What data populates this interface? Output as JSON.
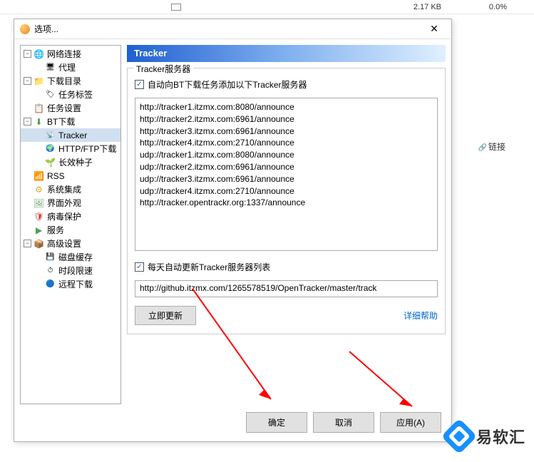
{
  "bg": {
    "size": "2.17 KB",
    "pct": "0.0%",
    "link": "链接"
  },
  "dialog": {
    "title": "选项..."
  },
  "tree": [
    {
      "label": "网络连接",
      "icon": "ic-globe",
      "indent": 0,
      "toggle": "−"
    },
    {
      "label": "代理",
      "icon": "ic-server",
      "indent": 1,
      "toggle": ""
    },
    {
      "label": "下载目录",
      "icon": "ic-folder",
      "indent": 0,
      "toggle": "−"
    },
    {
      "label": "任务标签",
      "icon": "ic-tag",
      "indent": 1,
      "toggle": ""
    },
    {
      "label": "任务设置",
      "icon": "ic-task",
      "indent": 0,
      "toggle": ""
    },
    {
      "label": "BT下载",
      "icon": "ic-bt",
      "indent": 0,
      "toggle": "−"
    },
    {
      "label": "Tracker",
      "icon": "ic-tracker",
      "indent": 1,
      "toggle": "",
      "selected": true
    },
    {
      "label": "HTTP/FTP下载",
      "icon": "ic-http",
      "indent": 1,
      "toggle": ""
    },
    {
      "label": "长效种子",
      "icon": "ic-seed",
      "indent": 1,
      "toggle": ""
    },
    {
      "label": "RSS",
      "icon": "ic-rss",
      "indent": 0,
      "toggle": ""
    },
    {
      "label": "系统集成",
      "icon": "ic-sys",
      "indent": 0,
      "toggle": ""
    },
    {
      "label": "界面外观",
      "icon": "ic-ui",
      "indent": 0,
      "toggle": ""
    },
    {
      "label": "病毒保护",
      "icon": "ic-virus",
      "indent": 0,
      "toggle": ""
    },
    {
      "label": "服务",
      "icon": "ic-service",
      "indent": 0,
      "toggle": ""
    },
    {
      "label": "高级设置",
      "icon": "ic-adv",
      "indent": 0,
      "toggle": "−"
    },
    {
      "label": "磁盘缓存",
      "icon": "ic-disk",
      "indent": 1,
      "toggle": ""
    },
    {
      "label": "时段限速",
      "icon": "ic-time",
      "indent": 1,
      "toggle": ""
    },
    {
      "label": "远程下载",
      "icon": "ic-remote",
      "indent": 1,
      "toggle": ""
    }
  ],
  "panel": {
    "header": "Tracker",
    "fieldset_legend": "Tracker服务器",
    "chk1_label": "自动向BT下载任务添加以下Tracker服务器",
    "trackers": "http://tracker1.itzmx.com:8080/announce\nhttp://tracker2.itzmx.com:6961/announce\nhttp://tracker3.itzmx.com:6961/announce\nhttp://tracker4.itzmx.com:2710/announce\nudp://tracker1.itzmx.com:8080/announce\nudp://tracker2.itzmx.com:6961/announce\nudp://tracker3.itzmx.com:6961/announce\nudp://tracker4.itzmx.com:2710/announce\nhttp://tracker.opentrackr.org:1337/announce",
    "chk2_label": "每天自动更新Tracker服务器列表",
    "update_url": "http://github.itzmx.com/1265578519/OpenTracker/master/track",
    "update_btn": "立即更新",
    "help_link": "详细帮助"
  },
  "footer": {
    "ok": "确定",
    "cancel": "取消",
    "apply": "应用(A)"
  },
  "watermark": "易软汇"
}
